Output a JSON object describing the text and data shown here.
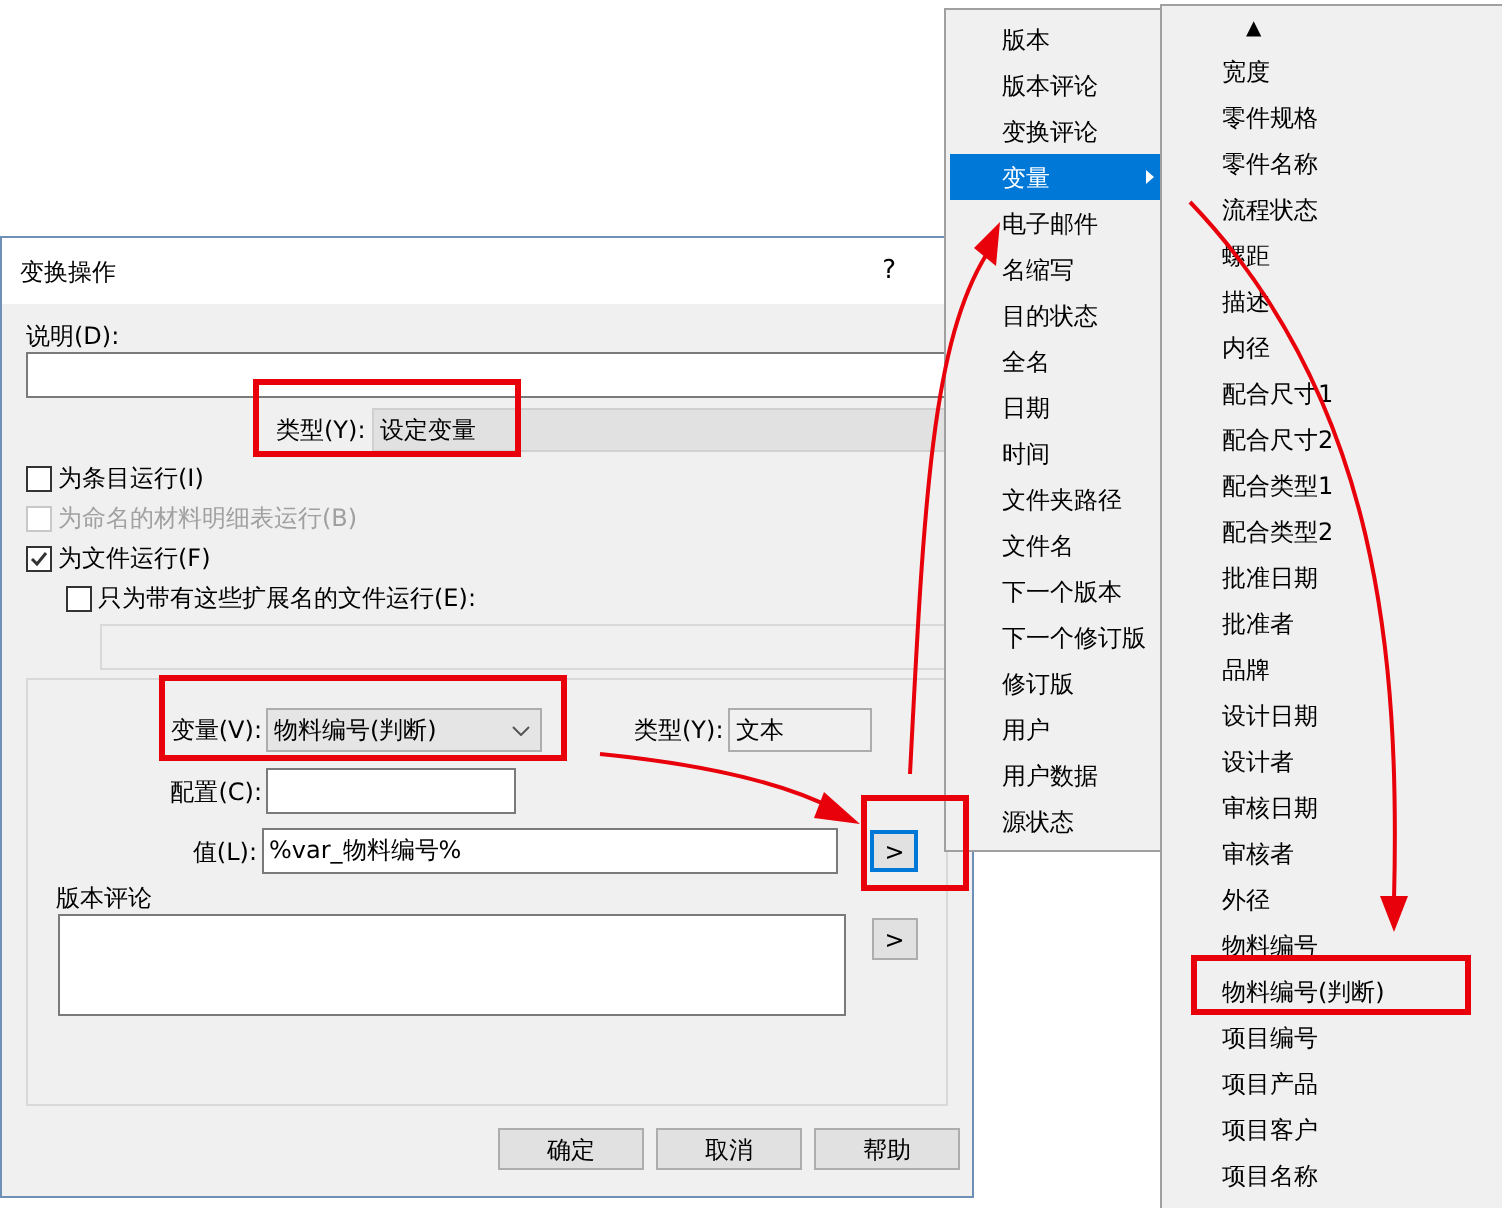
{
  "dialog": {
    "title": "变换操作",
    "help_button": "?",
    "description_label": "说明(D):",
    "type_label": "类型(Y):",
    "type_value": "设定变量",
    "checkboxes": [
      {
        "label": "为条目运行(I)",
        "checked": false,
        "disabled": false,
        "indented": false
      },
      {
        "label": "为命名的材料明细表运行(B)",
        "checked": false,
        "disabled": true,
        "indented": false
      },
      {
        "label": "为文件运行(F)",
        "checked": true,
        "disabled": false,
        "indented": false
      },
      {
        "label": "只为带有这些扩展名的文件运行(E):",
        "checked": false,
        "disabled": false,
        "indented": true
      }
    ],
    "variable_label": "变量(V):",
    "variable_value": "物料编号(判断)",
    "variable_type_label": "类型(Y):",
    "variable_type_value": "文本",
    "config_label": "配置(C):",
    "value_label": "值(L):",
    "value": "%var_物料编号%",
    "value_button": ">",
    "comment_label": "版本评论",
    "comment_button": ">",
    "buttons": [
      "确定",
      "取消",
      "帮助"
    ]
  },
  "menu": {
    "items": [
      {
        "label": "版本",
        "selected": false,
        "submenu": false
      },
      {
        "label": "版本评论",
        "selected": false,
        "submenu": false
      },
      {
        "label": "变换评论",
        "selected": false,
        "submenu": false
      },
      {
        "label": "变量",
        "selected": true,
        "submenu": true
      },
      {
        "label": "电子邮件",
        "selected": false,
        "submenu": false
      },
      {
        "label": "名缩写",
        "selected": false,
        "submenu": false
      },
      {
        "label": "目的状态",
        "selected": false,
        "submenu": false
      },
      {
        "label": "全名",
        "selected": false,
        "submenu": false
      },
      {
        "label": "日期",
        "selected": false,
        "submenu": false
      },
      {
        "label": "时间",
        "selected": false,
        "submenu": false
      },
      {
        "label": "文件夹路径",
        "selected": false,
        "submenu": false
      },
      {
        "label": "文件名",
        "selected": false,
        "submenu": false
      },
      {
        "label": "下一个版本",
        "selected": false,
        "submenu": false
      },
      {
        "label": "下一个修订版",
        "selected": false,
        "submenu": false
      },
      {
        "label": "修订版",
        "selected": false,
        "submenu": false
      },
      {
        "label": "用户",
        "selected": false,
        "submenu": false
      },
      {
        "label": "用户数据",
        "selected": false,
        "submenu": false
      },
      {
        "label": "源状态",
        "selected": false,
        "submenu": false
      }
    ]
  },
  "submenu": {
    "scroll_up": "▲",
    "items": [
      "宽度",
      "零件规格",
      "零件名称",
      "流程状态",
      "螺距",
      "描述",
      "内径",
      "配合尺寸1",
      "配合尺寸2",
      "配合类型1",
      "配合类型2",
      "批准日期",
      "批准者",
      "品牌",
      "设计日期",
      "设计者",
      "审核日期",
      "审核者",
      "外径",
      "物料编号",
      "物料编号(判断)",
      "项目编号",
      "项目产品",
      "项目客户",
      "项目名称"
    ]
  }
}
